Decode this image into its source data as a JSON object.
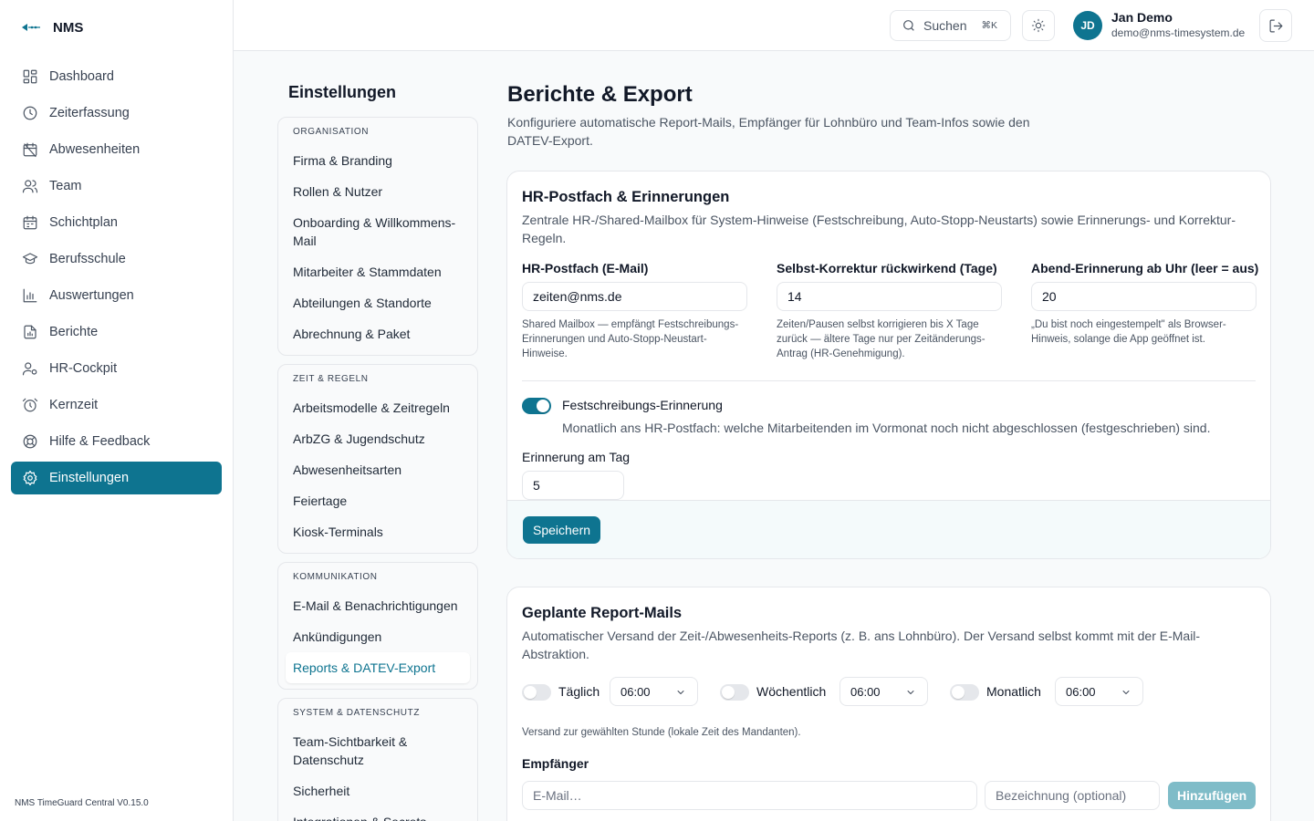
{
  "brand": {
    "name": "NMS"
  },
  "sidebar": {
    "items": [
      {
        "label": "Dashboard",
        "icon": "dashboard-icon"
      },
      {
        "label": "Zeiterfassung",
        "icon": "clock-icon"
      },
      {
        "label": "Abwesenheiten",
        "icon": "calendar-off-icon"
      },
      {
        "label": "Team",
        "icon": "users-icon"
      },
      {
        "label": "Schichtplan",
        "icon": "calendar-icon"
      },
      {
        "label": "Berufsschule",
        "icon": "graduation-cap-icon"
      },
      {
        "label": "Auswertungen",
        "icon": "bar-chart-icon"
      },
      {
        "label": "Berichte",
        "icon": "file-chart-icon"
      },
      {
        "label": "HR-Cockpit",
        "icon": "user-cog-icon"
      },
      {
        "label": "Kernzeit",
        "icon": "alarm-clock-icon"
      },
      {
        "label": "Hilfe & Feedback",
        "icon": "help-circle-icon"
      },
      {
        "label": "Einstellungen",
        "icon": "gear-icon",
        "active": true
      }
    ],
    "version": "NMS TimeGuard Central V0.15.0"
  },
  "topbar": {
    "search_label": "Suchen",
    "search_shortcut": "⌘K",
    "user": {
      "initials": "JD",
      "name": "Jan Demo",
      "email": "demo@nms-timesystem.de"
    }
  },
  "settings_nav": {
    "title": "Einstellungen",
    "groups": [
      {
        "title": "ORGANISATION",
        "items": [
          "Firma & Branding",
          "Rollen & Nutzer",
          "Onboarding & Willkommens-Mail",
          "Mitarbeiter & Stammdaten",
          "Abteilungen & Standorte",
          "Abrechnung & Paket"
        ]
      },
      {
        "title": "ZEIT & REGELN",
        "items": [
          "Arbeitsmodelle & Zeitregeln",
          "ArbZG & Jugendschutz",
          "Abwesenheitsarten",
          "Feiertage",
          "Kiosk-Terminals"
        ]
      },
      {
        "title": "KOMMUNIKATION",
        "items": [
          "E-Mail & Benachrichtigungen",
          "Ankündigungen",
          "Reports & DATEV-Export"
        ]
      },
      {
        "title": "SYSTEM & DATENSCHUTZ",
        "items": [
          "Team-Sichtbarkeit & Datenschutz",
          "Sicherheit",
          "Integrationen & Secrets"
        ]
      }
    ]
  },
  "page": {
    "title": "Berichte & Export",
    "description": "Konfiguriere automatische Report-Mails, Empfänger für Lohnbüro und Team-Infos sowie den DATEV-Export."
  },
  "hr_card": {
    "title": "HR-Postfach & Erinnerungen",
    "description": "Zentrale HR-/Shared-Mailbox für System-Hinweise (Festschreibung, Auto-Stopp-Neustarts) sowie Erinnerungs- und Korrektur-Regeln.",
    "fields": [
      {
        "label": "HR-Postfach (E-Mail)",
        "value": "zeiten@nms.de",
        "help": "Shared Mailbox — empfängt Festschreibungs-Erinnerungen und Auto-Stopp-Neustart-Hinweise."
      },
      {
        "label": "Selbst-Korrektur rückwirkend (Tage)",
        "value": "14",
        "help": "Zeiten/Pausen selbst korrigieren bis X Tage zurück — ältere Tage nur per Zeitänderungs-Antrag (HR-Genehmigung)."
      },
      {
        "label": "Abend-Erinnerung ab Uhr (leer = aus)",
        "value": "20",
        "help": "„Du bist noch eingestempelt\" als Browser-Hinweis, solange die App geöffnet ist."
      }
    ],
    "toggle": {
      "label": "Festschreibungs-Erinnerung",
      "on": true,
      "description": "Monatlich ans HR-Postfach: welche Mitarbeitenden im Vormonat noch nicht abgeschlossen (festgeschrieben) sind."
    },
    "reminder_day": {
      "label": "Erinnerung am Tag",
      "value": "5"
    },
    "save_label": "Speichern"
  },
  "report_card": {
    "title": "Geplante Report-Mails",
    "description": "Automatischer Versand der Zeit-/Abwesenheits-Reports (z. B. ans Lohnbüro). Der Versand selbst kommt mit der E-Mail-Abstraktion.",
    "schedules": [
      {
        "label": "Täglich",
        "on": false,
        "time": "06:00"
      },
      {
        "label": "Wöchentlich",
        "on": false,
        "time": "06:00"
      },
      {
        "label": "Monatlich",
        "on": false,
        "time": "06:00"
      }
    ],
    "schedule_hint": "Versand zur gewählten Stunde (lokale Zeit des Mandanten).",
    "recipients": {
      "label": "Empfänger",
      "email_placeholder": "E-Mail…",
      "name_placeholder": "Bezeichnung (optional)",
      "add_label": "Hinzufügen"
    }
  }
}
